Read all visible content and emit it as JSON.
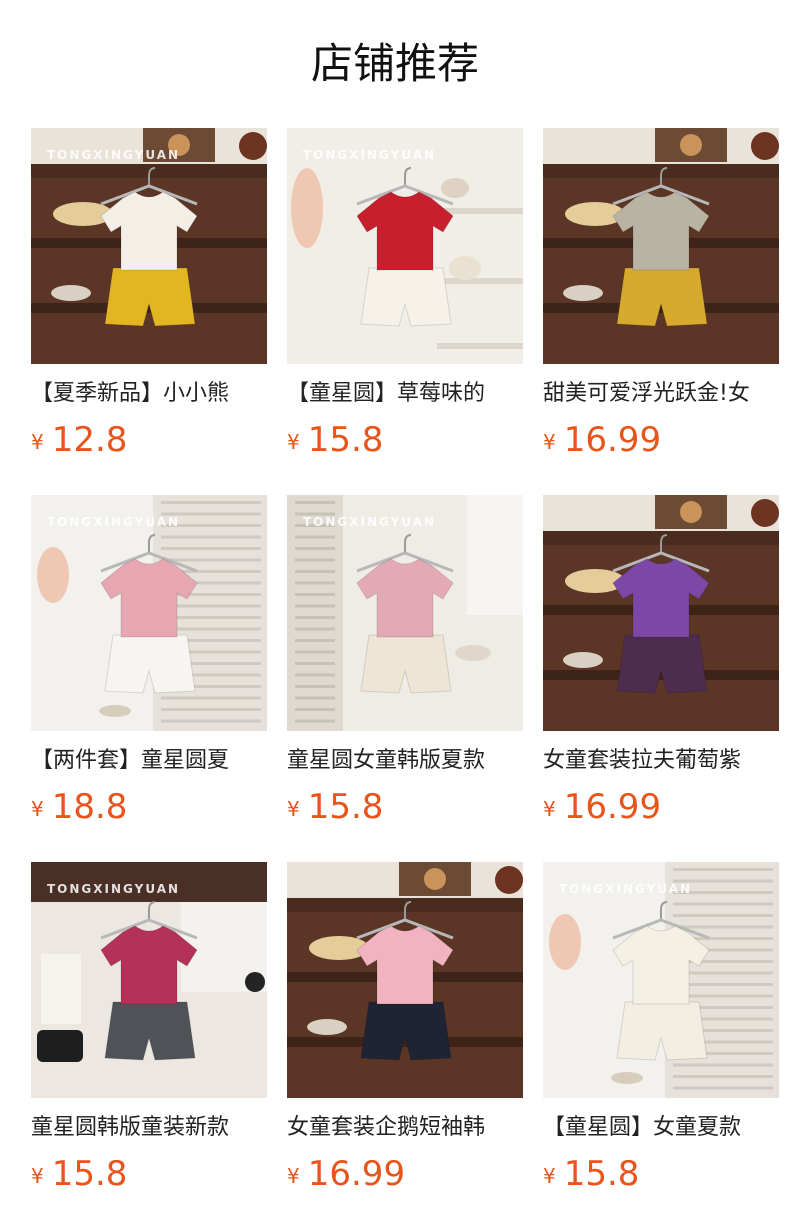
{
  "page_title": "店铺推荐",
  "currency_symbol": "¥",
  "colors": {
    "price": "#e8541a",
    "title": "#111111",
    "name": "#222222"
  },
  "products": [
    {
      "name": "【夏季新品】小小熊",
      "price": "12.8",
      "watermark": "TONGXINGYUAN",
      "scene": "shelf",
      "top_color": "#f4efe6",
      "bottom_color": "#e2b522"
    },
    {
      "name": "【童星圆】草莓味的",
      "price": "15.8",
      "watermark": "TONGXINGYUAN",
      "scene": "white",
      "top_color": "#c5202c",
      "bottom_color": "#f6f2ea"
    },
    {
      "name": "甜美可爱浮光跃金!女",
      "price": "16.99",
      "watermark": "",
      "scene": "shelf",
      "top_color": "#b9b3a3",
      "bottom_color": "#d6aa2c"
    },
    {
      "name": "【两件套】童星圆夏",
      "price": "18.8",
      "watermark": "TONGXINGYUAN",
      "scene": "shutter",
      "top_color": "#e6a7b2",
      "bottom_color": "#f7f4f2"
    },
    {
      "name": "童星圆女童韩版夏款",
      "price": "15.8",
      "watermark": "TONGXINGYUAN",
      "scene": "closet",
      "top_color": "#e4a9b6",
      "bottom_color": "#ede5d6"
    },
    {
      "name": "女童套装拉夫葡萄紫",
      "price": "16.99",
      "watermark": "",
      "scene": "shelf",
      "top_color": "#7b48a7",
      "bottom_color": "#4e2c4f"
    },
    {
      "name": "童星圆韩版童装新款",
      "price": "15.8",
      "watermark": "TONGXINGYUAN",
      "scene": "flatlay",
      "top_color": "#b3315a",
      "bottom_color": "#4f5256"
    },
    {
      "name": "女童套装企鹅短袖韩",
      "price": "16.99",
      "watermark": "",
      "scene": "shelf",
      "top_color": "#f2b3c1",
      "bottom_color": "#1e2433"
    },
    {
      "name": "【童星圆】女童夏款",
      "price": "15.8",
      "watermark": "TONGXINGYUAN",
      "scene": "shutter",
      "top_color": "#f5f0e4",
      "bottom_color": "#f3ede2"
    }
  ]
}
